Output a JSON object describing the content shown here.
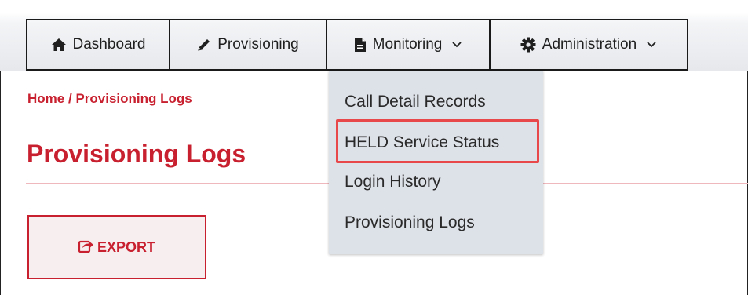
{
  "nav": {
    "dashboard": "Dashboard",
    "provisioning": "Provisioning",
    "monitoring": "Monitoring",
    "administration": "Administration",
    "icons": {
      "dashboard": "home-icon",
      "provisioning": "pencil-icon",
      "monitoring": "document-icon",
      "administration": "gear-icon",
      "dropdown": "chevron-down-icon"
    }
  },
  "breadcrumb": {
    "home": "Home",
    "separator": "/",
    "current": "Provisioning Logs"
  },
  "page": {
    "title": "Provisioning Logs",
    "export_label": "EXPORT",
    "export_icon": "share-icon"
  },
  "monitoring_menu": {
    "items": [
      "Call Detail Records",
      "HELD Service Status",
      "Login History",
      "Provisioning Logs"
    ],
    "highlighted_index": 1
  },
  "colors": {
    "accent": "#c8202f",
    "highlight_box": "#e8484a",
    "menu_bg": "#dde1e8"
  }
}
